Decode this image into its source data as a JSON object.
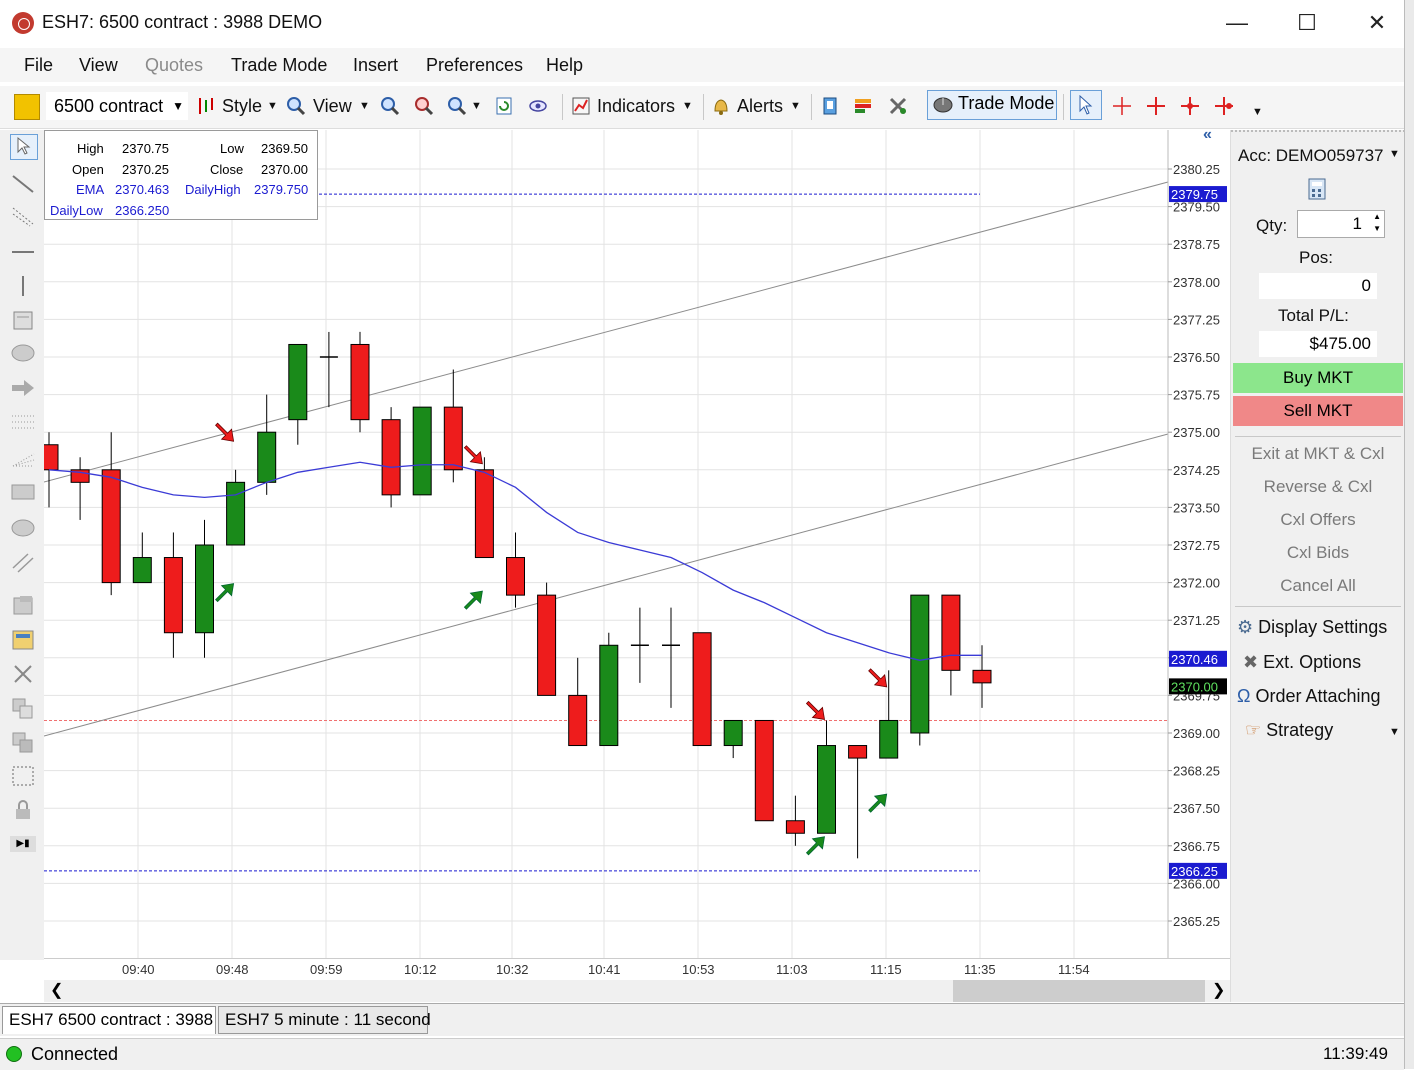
{
  "window": {
    "title": "ESH7: 6500 contract : 3988 DEMO"
  },
  "menu": [
    "File",
    "View",
    "Quotes",
    "Trade Mode",
    "Insert",
    "Preferences",
    "Help"
  ],
  "menu_disabled": [
    "Quotes"
  ],
  "toolbar": {
    "contract": "6500 contract",
    "style": "Style",
    "view": "View",
    "indicators": "Indicators",
    "alerts": "Alerts",
    "trade_mode": "Trade Mode"
  },
  "info": {
    "high_label": "High",
    "high": "2370.75",
    "low_label": "Low",
    "low": "2369.50",
    "open_label": "Open",
    "open": "2370.25",
    "close_label": "Close",
    "close": "2370.00",
    "ema_label": "EMA",
    "ema": "2370.463",
    "dailyhigh_label": "DailyHigh",
    "dailyhigh": "2379.750",
    "dailylow_label": "DailyLow",
    "dailylow": "2366.250"
  },
  "chart_data": {
    "type": "candlestick",
    "price_ticks": [
      "2380.25",
      "2379.50",
      "2378.75",
      "2378.00",
      "2377.25",
      "2376.50",
      "2375.75",
      "2375.00",
      "2374.25",
      "2373.50",
      "2372.75",
      "2372.00",
      "2371.25",
      "2370.50",
      "2369.75",
      "2369.00",
      "2368.25",
      "2367.50",
      "2366.75",
      "2366.00",
      "2365.25"
    ],
    "time_ticks": [
      "09:40",
      "09:48",
      "09:59",
      "10:12",
      "10:32",
      "10:41",
      "10:53",
      "11:03",
      "11:15",
      "11:35",
      "11:54"
    ],
    "candles": [
      {
        "o": 2374.75,
        "h": 2375.0,
        "l": 2373.5,
        "c": 2374.25
      },
      {
        "o": 2374.25,
        "h": 2374.5,
        "l": 2373.25,
        "c": 2374.0
      },
      {
        "o": 2374.25,
        "h": 2375.0,
        "l": 2371.75,
        "c": 2372.0
      },
      {
        "o": 2372.0,
        "h": 2373.0,
        "l": 2372.0,
        "c": 2372.5
      },
      {
        "o": 2372.5,
        "h": 2373.0,
        "l": 2370.5,
        "c": 2371.0
      },
      {
        "o": 2371.0,
        "h": 2373.25,
        "l": 2370.5,
        "c": 2372.75
      },
      {
        "o": 2372.75,
        "h": 2374.25,
        "l": 2372.75,
        "c": 2374.0
      },
      {
        "o": 2374.0,
        "h": 2375.75,
        "l": 2373.75,
        "c": 2375.0
      },
      {
        "o": 2375.25,
        "h": 2376.75,
        "l": 2374.75,
        "c": 2376.75
      },
      {
        "o": 2376.5,
        "h": 2377.0,
        "l": 2375.5,
        "c": 2376.5
      },
      {
        "o": 2376.75,
        "h": 2377.0,
        "l": 2375.0,
        "c": 2375.25
      },
      {
        "o": 2375.25,
        "h": 2375.5,
        "l": 2373.5,
        "c": 2373.75
      },
      {
        "o": 2373.75,
        "h": 2375.5,
        "l": 2373.75,
        "c": 2375.5
      },
      {
        "o": 2375.5,
        "h": 2376.25,
        "l": 2374.0,
        "c": 2374.25
      },
      {
        "o": 2374.25,
        "h": 2374.5,
        "l": 2372.5,
        "c": 2372.5
      },
      {
        "o": 2372.5,
        "h": 2373.0,
        "l": 2371.5,
        "c": 2371.75
      },
      {
        "o": 2371.75,
        "h": 2372.0,
        "l": 2369.75,
        "c": 2369.75
      },
      {
        "o": 2369.75,
        "h": 2370.5,
        "l": 2368.75,
        "c": 2368.75
      },
      {
        "o": 2368.75,
        "h": 2371.0,
        "l": 2368.75,
        "c": 2370.75
      },
      {
        "o": 2370.75,
        "h": 2371.5,
        "l": 2370.0,
        "c": 2370.75
      },
      {
        "o": 2370.75,
        "h": 2371.5,
        "l": 2369.5,
        "c": 2370.75
      },
      {
        "o": 2371.0,
        "h": 2371.0,
        "l": 2368.75,
        "c": 2368.75
      },
      {
        "o": 2368.75,
        "h": 2369.0,
        "l": 2368.5,
        "c": 2369.25
      },
      {
        "o": 2369.25,
        "h": 2369.25,
        "l": 2367.25,
        "c": 2367.25
      },
      {
        "o": 2367.25,
        "h": 2367.75,
        "l": 2366.75,
        "c": 2367.0
      },
      {
        "o": 2367.0,
        "h": 2369.25,
        "l": 2367.0,
        "c": 2368.75
      },
      {
        "o": 2368.75,
        "h": 2368.75,
        "l": 2366.5,
        "c": 2368.5
      },
      {
        "o": 2368.5,
        "h": 2370.25,
        "l": 2368.5,
        "c": 2369.25
      },
      {
        "o": 2369.0,
        "h": 2371.75,
        "l": 2368.75,
        "c": 2371.75
      },
      {
        "o": 2371.75,
        "h": 2371.75,
        "l": 2369.75,
        "c": 2370.25
      },
      {
        "o": 2370.25,
        "h": 2370.75,
        "l": 2369.5,
        "c": 2370.0
      }
    ],
    "ema": [
      2374.25,
      2374.2,
      2374.1,
      2373.9,
      2373.75,
      2373.7,
      2373.75,
      2374.0,
      2374.2,
      2374.3,
      2374.4,
      2374.3,
      2374.35,
      2374.35,
      2374.2,
      2373.9,
      2373.4,
      2373.0,
      2372.8,
      2372.65,
      2372.5,
      2372.2,
      2371.85,
      2371.6,
      2371.3,
      2371.0,
      2370.8,
      2370.6,
      2370.45,
      2370.55,
      2370.55
    ],
    "daily_high": 2379.75,
    "daily_low": 2366.25,
    "pl_line": 2369.25,
    "last_price": "2370.00",
    "ema_label": "2370.46",
    "daily_high_label": "2379.75",
    "daily_low_label": "2366.25"
  },
  "panel": {
    "account": "Acc: DEMO059737",
    "qty_label": "Qty:",
    "qty": "1",
    "pos_label": "Pos:",
    "pos": "0",
    "pl_label": "Total P/L:",
    "pl": "$475.00",
    "buy": "Buy MKT",
    "sell": "Sell MKT",
    "exit": "Exit at MKT & Cxl",
    "reverse": "Reverse & Cxl",
    "cxl_offers": "Cxl Offers",
    "cxl_bids": "Cxl Bids",
    "cancel_all": "Cancel All",
    "display_settings": "Display Settings",
    "ext_options": "Ext. Options",
    "order_attaching": "Order Attaching",
    "strategy": "Strategy"
  },
  "tabs": [
    "ESH7 6500 contract : 3988",
    "ESH7 5 minute : 11 second"
  ],
  "status": {
    "connection": "Connected",
    "time": "11:39:49"
  },
  "colors": {
    "up": "#1a8a1a",
    "down": "#ee1c1c",
    "ema": "#3b3bd6",
    "buy": "#8ce68c",
    "sell": "#f08888"
  }
}
